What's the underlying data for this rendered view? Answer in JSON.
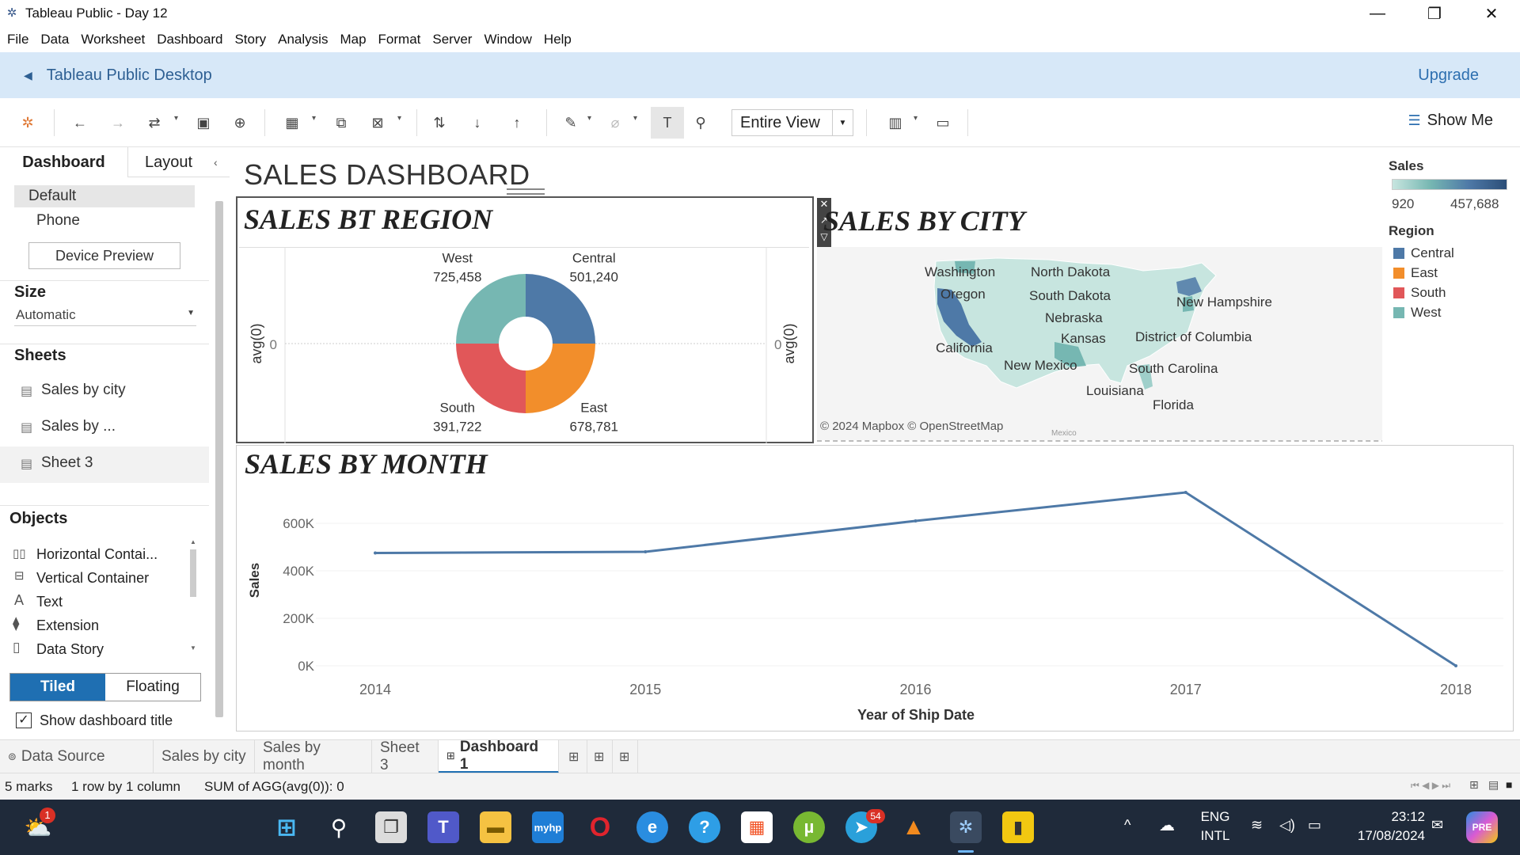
{
  "window": {
    "title": "Tableau Public - Day 12",
    "minimize_icon": "minimize-icon",
    "maximize_icon": "restore-icon",
    "close_icon": "close-icon"
  },
  "menu": [
    "File",
    "Data",
    "Worksheet",
    "Dashboard",
    "Story",
    "Analysis",
    "Map",
    "Format",
    "Server",
    "Window",
    "Help"
  ],
  "banner": {
    "title": "Tableau Public Desktop",
    "upgrade": "Upgrade"
  },
  "toolbar": {
    "fit_value": "Entire View",
    "show_me": "Show Me"
  },
  "left_panel": {
    "tabs": [
      "Dashboard",
      "Layout"
    ],
    "devices": [
      "Default",
      "Phone"
    ],
    "device_preview": "Device Preview",
    "size_label": "Size",
    "size_value": "Automatic",
    "sheets_label": "Sheets",
    "sheets": [
      "Sales by city",
      "Sales by ...",
      "Sheet 3"
    ],
    "objects_label": "Objects",
    "objects": [
      "Horizontal Contai...",
      "Vertical Container",
      "Text",
      "Extension",
      "Data Story"
    ],
    "tiled": "Tiled",
    "floating": "Floating",
    "show_title": "Show dashboard title",
    "show_title_checked": true
  },
  "dashboard": {
    "title": "SALES DASHBOARD",
    "region_title": "SALES BT REGION",
    "city_title": "SALES BY CITY",
    "month_title": "SALES BY MONTH",
    "map_credit": "© 2024 Mapbox © OpenStreetMap",
    "map_labels": [
      "Washington",
      "North Dakota",
      "Oregon",
      "South Dakota",
      "New Hampshire",
      "Nebraska",
      "Kansas",
      "District of Columbia",
      "California",
      "New Mexico",
      "South Carolina",
      "Louisiana",
      "Florida",
      "Mexico"
    ],
    "pie_axis_label": "avg(0)",
    "pie_axis_zero": "0",
    "legend": {
      "sales_title": "Sales",
      "sales_min": "920",
      "sales_max": "457,688",
      "region_title": "Region",
      "regions": [
        {
          "name": "Central",
          "color": "#4e79a7"
        },
        {
          "name": "East",
          "color": "#f28e2b"
        },
        {
          "name": "South",
          "color": "#e15759"
        },
        {
          "name": "West",
          "color": "#76b7b2"
        }
      ]
    }
  },
  "chart_data": [
    {
      "type": "pie",
      "title": "SALES BT REGION",
      "categories": [
        "Central",
        "East",
        "South",
        "West"
      ],
      "values": [
        501240,
        678781,
        391722,
        725458
      ],
      "labels": [
        "501,240",
        "678,781",
        "391,722",
        "725,458"
      ],
      "colors": [
        "#4e79a7",
        "#f28e2b",
        "#e15759",
        "#76b7b2"
      ]
    },
    {
      "type": "line",
      "title": "SALES BY MONTH",
      "xlabel": "Year of Ship Date",
      "ylabel": "Sales",
      "x": [
        "2014",
        "2015",
        "2016",
        "2017",
        "2018"
      ],
      "values": [
        475000,
        480000,
        610000,
        730000,
        0
      ],
      "yticks": [
        "0K",
        "200K",
        "400K",
        "600K"
      ],
      "ylim": [
        0,
        720000
      ],
      "color": "#4e79a7"
    }
  ],
  "tabs": {
    "data_source": "Data Source",
    "sheets": [
      "Sales by city",
      "Sales by month",
      "Sheet 3"
    ],
    "active": "Dashboard 1"
  },
  "status": {
    "marks": "5 marks",
    "rows": "1 row  by  1 column",
    "sum": "SUM of AGG(avg(0)): 0"
  },
  "taskbar": {
    "lang1": "ENG",
    "lang2": "INTL",
    "time": "23:12",
    "date": "17/08/2024",
    "badge_weather": "1",
    "badge_telegram": "54"
  }
}
